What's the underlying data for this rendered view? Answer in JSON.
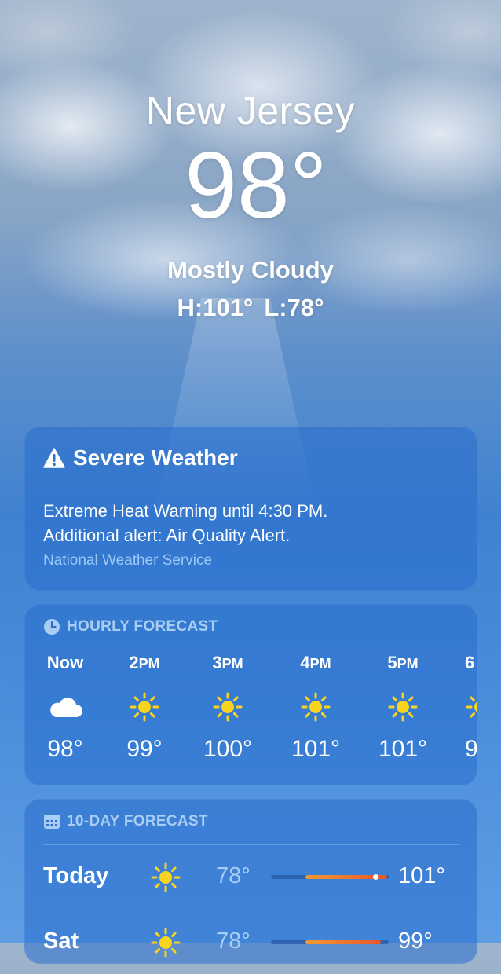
{
  "location": {
    "city": "New Jersey",
    "temperature": "98°",
    "condition": "Mostly Cloudy",
    "high": "H:101°",
    "low": "L:78°"
  },
  "alert": {
    "title": "Severe Weather",
    "line1": "Extreme Heat Warning until 4:30 PM.",
    "line2": "Additional alert: Air Quality Alert.",
    "source": "National Weather Service"
  },
  "hourly": {
    "title": "HOURLY FORECAST",
    "items": [
      {
        "time": "Now",
        "icon": "cloud-icon",
        "temp": "98°"
      },
      {
        "time": "2",
        "suffix": "PM",
        "icon": "sun-icon",
        "temp": "99°"
      },
      {
        "time": "3",
        "suffix": "PM",
        "icon": "sun-icon",
        "temp": "100°"
      },
      {
        "time": "4",
        "suffix": "PM",
        "icon": "sun-icon",
        "temp": "101°"
      },
      {
        "time": "5",
        "suffix": "PM",
        "icon": "sun-icon",
        "temp": "101°"
      },
      {
        "time": "6",
        "suffix": "",
        "icon": "sun-icon",
        "temp": "9"
      }
    ]
  },
  "daily": {
    "title": "10-DAY FORECAST",
    "days": [
      {
        "name": "Today",
        "icon": "sun-icon",
        "low": "78°",
        "high": "101°"
      },
      {
        "name": "Sat",
        "icon": "sun-icon",
        "low": "78°",
        "high": "99°"
      }
    ]
  },
  "colors": {
    "card": "#2f6fcb",
    "muted_text": "#a9cdf3",
    "range_start": "#f29a33",
    "range_end": "#e8562d"
  }
}
